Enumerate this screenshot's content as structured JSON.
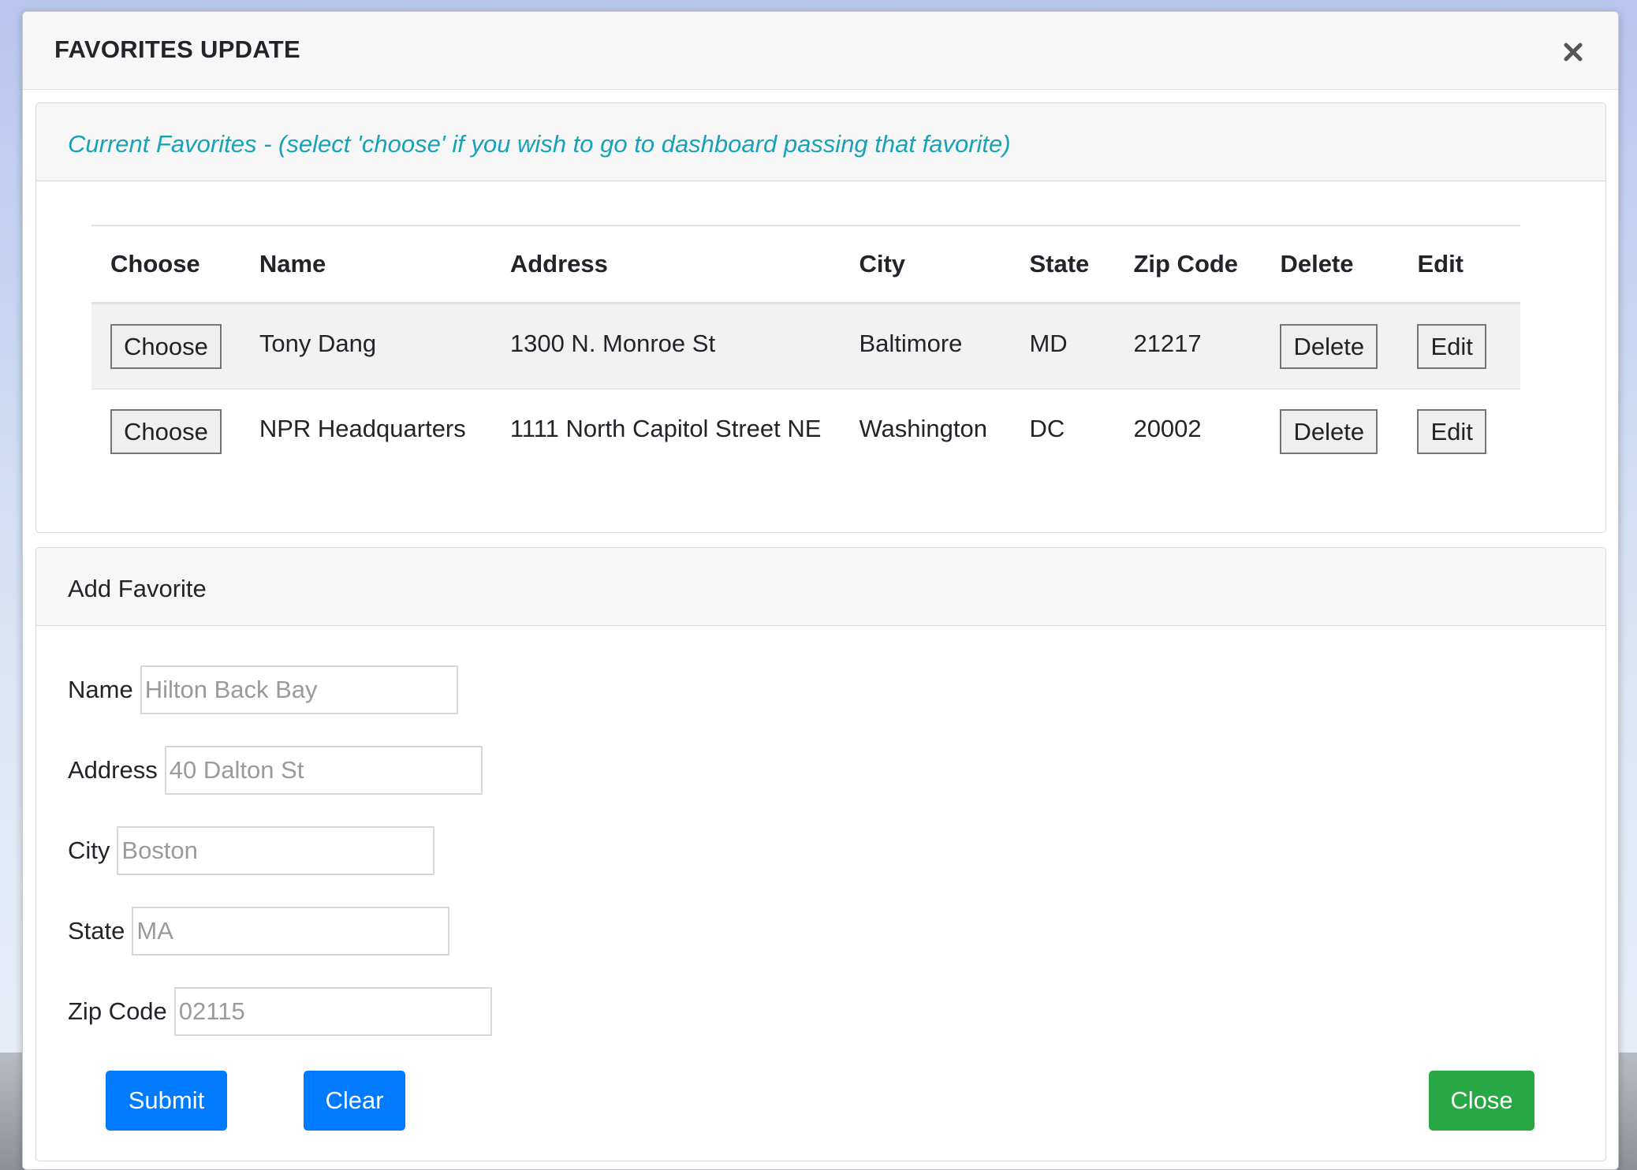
{
  "modal": {
    "title": "FAVORITES UPDATE",
    "close_icon": "close-icon"
  },
  "favorites": {
    "heading": "Current Favorites - (select 'choose' if you wish to go to dashboard passing that favorite)",
    "columns": [
      "Choose",
      "Name",
      "Address",
      "City",
      "State",
      "Zip Code",
      "Delete",
      "Edit"
    ],
    "rows": [
      {
        "choose_label": "Choose",
        "name": "Tony Dang",
        "address": "1300 N. Monroe St",
        "city": "Baltimore",
        "state": "MD",
        "zip": "21217",
        "delete_label": "Delete",
        "edit_label": "Edit"
      },
      {
        "choose_label": "Choose",
        "name": "NPR Headquarters",
        "address": "1111 North Capitol Street NE",
        "city": "Washington",
        "state": "DC",
        "zip": "20002",
        "delete_label": "Delete",
        "edit_label": "Edit"
      }
    ]
  },
  "add_favorite": {
    "heading": "Add Favorite",
    "fields": {
      "name": {
        "label": "Name",
        "placeholder": "Hilton Back Bay",
        "value": ""
      },
      "address": {
        "label": "Address",
        "placeholder": "40 Dalton St",
        "value": ""
      },
      "city": {
        "label": "City",
        "placeholder": "Boston",
        "value": ""
      },
      "state": {
        "label": "State",
        "placeholder": "MA",
        "value": ""
      },
      "zip": {
        "label": "Zip Code",
        "placeholder": "02115",
        "value": ""
      }
    },
    "submit_label": "Submit",
    "clear_label": "Clear",
    "close_label": "Close"
  },
  "colors": {
    "primary": "#007bff",
    "success": "#28a745",
    "info": "#17a2b8"
  }
}
